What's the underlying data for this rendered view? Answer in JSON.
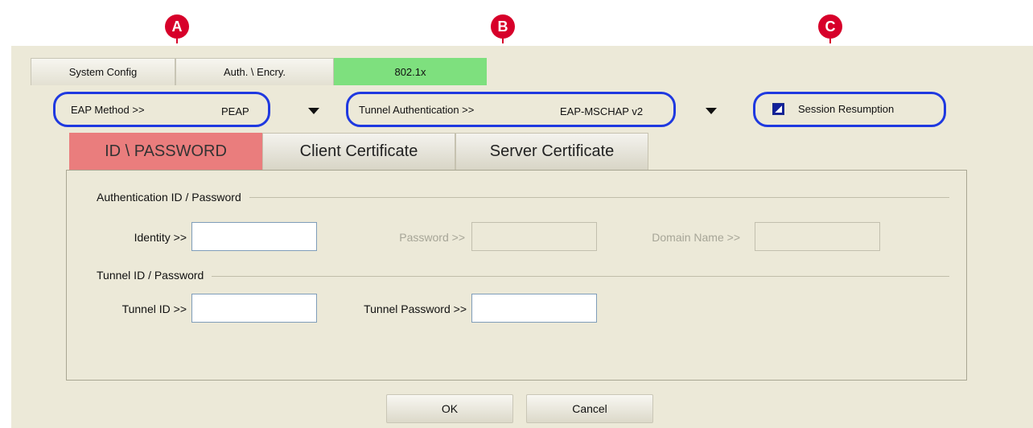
{
  "callouts": {
    "a": "A",
    "b": "B",
    "c": "C"
  },
  "tabs": [
    {
      "label": "System Config"
    },
    {
      "label": "Auth. \\ Encry."
    },
    {
      "label": "802.1x"
    }
  ],
  "eap": {
    "method_label": "EAP Method >>",
    "method_value": "PEAP",
    "tunnel_label": "Tunnel Authentication >>",
    "tunnel_value": "EAP-MSCHAP v2",
    "session_resumption_label": "Session Resumption",
    "session_resumption_checked": true
  },
  "subtabs": [
    {
      "label": "ID \\ PASSWORD"
    },
    {
      "label": "Client Certificate"
    },
    {
      "label": "Server Certificate"
    }
  ],
  "auth_group": {
    "title": "Authentication ID / Password",
    "identity_label": "Identity >>",
    "identity_value": "",
    "password_label": "Password >>",
    "domain_label": "Domain Name >>"
  },
  "tunnel_group": {
    "title": "Tunnel ID / Password",
    "tunnel_id_label": "Tunnel ID >>",
    "tunnel_password_label": "Tunnel Password >>"
  },
  "buttons": {
    "ok": "OK",
    "cancel": "Cancel"
  },
  "colors": {
    "active_tab": "#7ee07e",
    "active_subtab": "#ea7d7d",
    "callout": "#d7002a",
    "highlight_ring": "#1f39e0"
  }
}
